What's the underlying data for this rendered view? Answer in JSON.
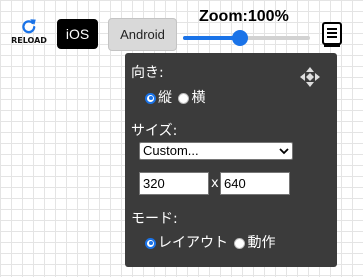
{
  "toolbar": {
    "reload_label": "RELOAD",
    "ios_label": "iOS",
    "android_label": "Android",
    "zoom_label": "Zoom:100%",
    "zoom_slider_fraction": 0.45
  },
  "panel": {
    "orientation": {
      "label": "向き:",
      "options": [
        "縦",
        "横"
      ],
      "selected": "縦"
    },
    "size": {
      "label": "サイズ:",
      "select_value": "Custom...",
      "width_value": "320",
      "separator": "x",
      "height_value": "640"
    },
    "mode": {
      "label": "モード:",
      "options": [
        "レイアウト",
        "動作"
      ],
      "selected": "レイアウト"
    }
  },
  "icons": {
    "reload": "reload-icon",
    "menu": "menu-icon",
    "move": "move-icon",
    "dropdown": "chevron-down-icon"
  },
  "colors": {
    "accent": "#1a73e8",
    "panel_bg": "#3b3b3b",
    "ios_bg": "#000000",
    "android_bg": "#d9d9d9"
  }
}
